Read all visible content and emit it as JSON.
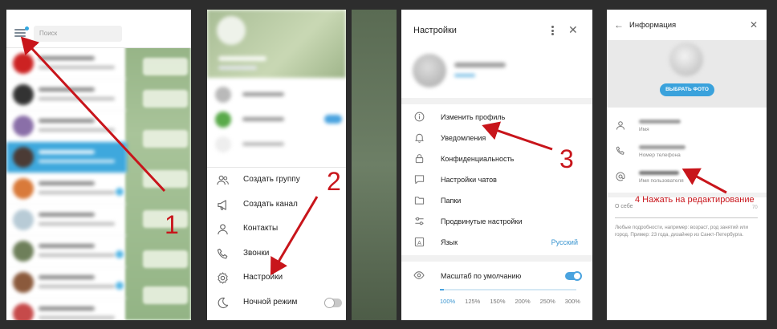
{
  "panel1": {
    "search_placeholder": "Поиск",
    "badge_color": "#33a8e0",
    "active_color": "#3ea8dd"
  },
  "panel2": {
    "menu": [
      {
        "icon": "group-icon",
        "label": "Создать группу"
      },
      {
        "icon": "megaphone-icon",
        "label": "Создать канал"
      },
      {
        "icon": "contacts-icon",
        "label": "Контакты"
      },
      {
        "icon": "phone-icon",
        "label": "Звонки"
      },
      {
        "icon": "gear-icon",
        "label": "Настройки"
      },
      {
        "icon": "moon-icon",
        "label": "Ночной режим"
      }
    ],
    "night_mode_on": false
  },
  "panel3": {
    "title": "Настройки",
    "menu": [
      {
        "icon": "info-icon",
        "label": "Изменить профиль"
      },
      {
        "icon": "bell-icon",
        "label": "Уведомления"
      },
      {
        "icon": "lock-icon",
        "label": "Конфиденциальность"
      },
      {
        "icon": "chat-icon",
        "label": "Настройки чатов"
      },
      {
        "icon": "folder-icon",
        "label": "Папки"
      },
      {
        "icon": "sliders-icon",
        "label": "Продвинутые настройки"
      },
      {
        "icon": "language-icon",
        "label": "Язык",
        "value": "Русский"
      }
    ],
    "scale_label": "Масштаб по умолчанию",
    "scale_default_on": true,
    "scale_options": [
      "100%",
      "125%",
      "150%",
      "200%",
      "250%",
      "300%"
    ],
    "scale_selected": "100%",
    "accent": "#4aa3df"
  },
  "panel4": {
    "title": "Информация",
    "photo_button": "ВЫБРАТЬ ФОТО",
    "fields": [
      {
        "icon": "person-icon",
        "caption": "Имя"
      },
      {
        "icon": "phone-icon",
        "caption": "Номер телефона"
      },
      {
        "icon": "at-icon",
        "caption": "Имя пользователя"
      }
    ],
    "about_label": "О себе",
    "about_counter": "70",
    "about_hint": "Любые подробности, например: возраст, род занятий или город. Пример: 23 года, дизайнер из Санкт-Петербурга."
  },
  "annotations": {
    "step1": "1",
    "step2": "2",
    "step3": "3",
    "step4": "4 Нажать на редактирование",
    "color": "#c8151b"
  }
}
